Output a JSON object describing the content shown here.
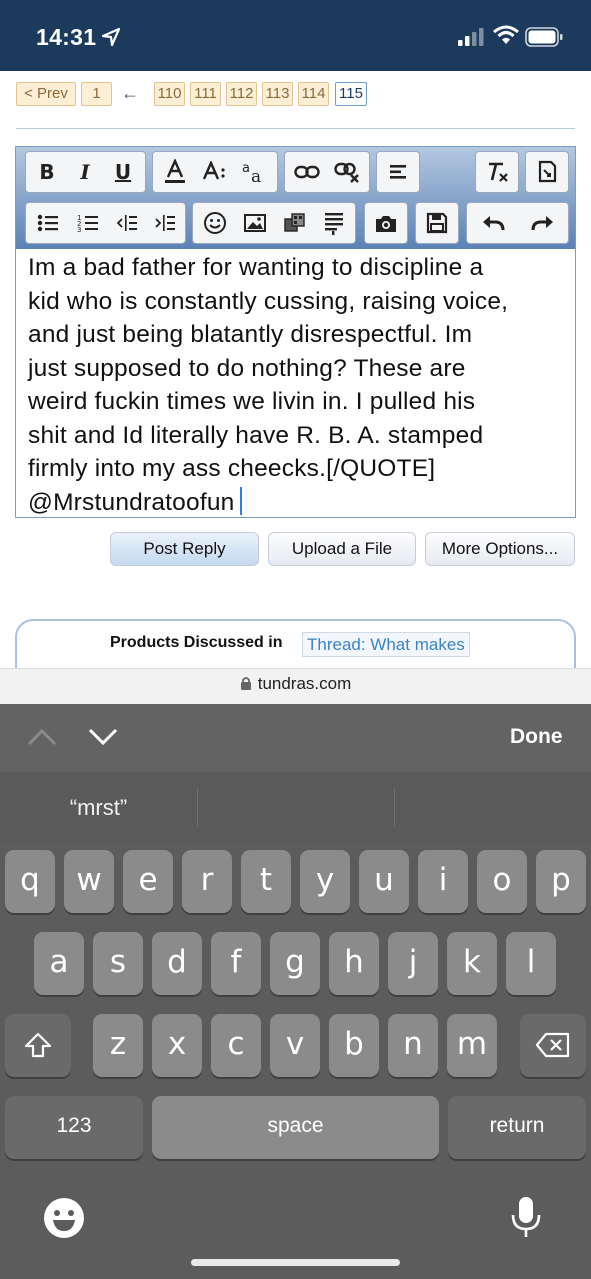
{
  "status": {
    "time": "14:31",
    "icons": [
      "location-arrow-icon",
      "cellular-signal-icon",
      "wifi-icon",
      "battery-icon"
    ]
  },
  "pagination": {
    "prev": "< Prev",
    "first": "1",
    "arrow": "←",
    "pages": [
      "110",
      "111",
      "112",
      "113",
      "114",
      "115"
    ],
    "current": "115"
  },
  "toolbar": {
    "row1": [
      "B",
      "I",
      "U"
    ],
    "icons": [
      "bold-icon",
      "italic-icon",
      "underline-icon",
      "text-color-icon",
      "font-size-icon",
      "font-family-icon",
      "link-icon",
      "unlink-icon",
      "align-icon",
      "remove-format-icon",
      "toggle-bbcode-icon",
      "bullet-list-icon",
      "numbered-list-icon",
      "outdent-icon",
      "indent-icon",
      "smiley-icon",
      "image-icon",
      "media-icon",
      "quote-icon",
      "camera-icon",
      "save-icon",
      "undo-icon",
      "redo-icon"
    ]
  },
  "editor": {
    "lines": [
      "Im a bad father for wanting to discipline a",
      "kid who is constantly cussing, raising voice,",
      "and just being blatantly disrespectful. Im",
      "just supposed to do nothing? These are",
      "weird fuckin times we livin in. I pulled his",
      "shit and Id literally have R. B. A. stamped",
      "firmly into my ass cheecks.[/QUOTE]",
      "@Mrstundratoofun"
    ]
  },
  "actions": {
    "post_reply": "Post Reply",
    "upload": "Upload a File",
    "more": "More Options..."
  },
  "products": {
    "label": "Products Discussed in",
    "link": "Thread: What makes"
  },
  "browser": {
    "url": "tundras.com"
  },
  "keyboard": {
    "done": "Done",
    "suggestion": "“mrst”",
    "row1": [
      "q",
      "w",
      "e",
      "r",
      "t",
      "y",
      "u",
      "i",
      "o",
      "p"
    ],
    "row2": [
      "a",
      "s",
      "d",
      "f",
      "g",
      "h",
      "j",
      "k",
      "l"
    ],
    "row3": [
      "z",
      "x",
      "c",
      "v",
      "b",
      "n",
      "m"
    ],
    "numbers": "123",
    "space": "space",
    "return": "return"
  }
}
